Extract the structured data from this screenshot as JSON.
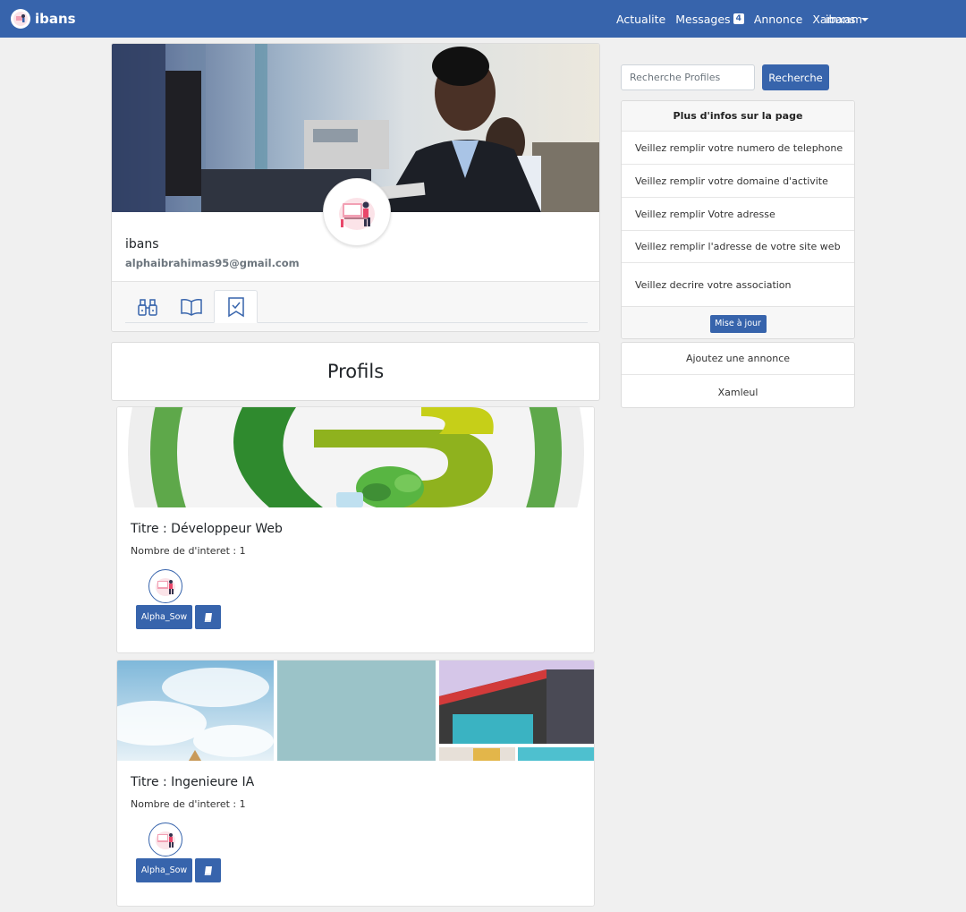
{
  "navbar": {
    "brand": "ibans",
    "links": [
      {
        "label": "Actualite"
      },
      {
        "label": "Messages",
        "badge": "4"
      },
      {
        "label": "Annonce"
      },
      {
        "label": "Xamxam"
      }
    ],
    "user": "ibans"
  },
  "profile": {
    "name": "ibans",
    "email": "alphaibrahimas95@gmail.com",
    "tabs": [
      {
        "icon": "binoculars-icon"
      },
      {
        "icon": "book-open-icon"
      },
      {
        "icon": "bookmark-check-icon",
        "active": true
      }
    ]
  },
  "profils": {
    "title": "Profils"
  },
  "posts": [
    {
      "title": "Titre : Développeur Web",
      "interest": "Nombre de d'interet : 1",
      "author": "Alpha_Sow",
      "book_icon": "book-icon"
    },
    {
      "title": "Titre : Ingenieure IA",
      "interest": "Nombre de d'interet : 1",
      "author": "Alpha_Sow",
      "book_icon": "book-icon"
    }
  ],
  "sidebar": {
    "search": {
      "placeholder": "Recherche Profiles",
      "button": "Recherche"
    },
    "info": {
      "title": "Plus d'infos sur la page",
      "items": [
        "Veillez remplir votre numero de telephone",
        "Veillez remplir votre domaine d'activite",
        "Veillez remplir Votre adresse",
        "Veillez remplir l'adresse de votre site web",
        "Veillez decrire votre association"
      ],
      "update_button": "Mise à jour"
    },
    "links": [
      "Ajoutez une annonce",
      "Xamleul"
    ]
  },
  "colors": {
    "primary": "#3764ac",
    "background": "#f0f0f0"
  }
}
